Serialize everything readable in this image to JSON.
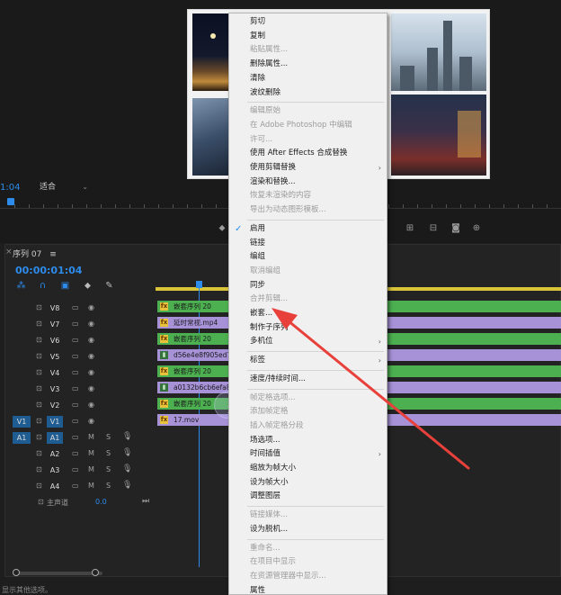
{
  "colors": {
    "accent": "#2d8ceb",
    "clip_green": "#4caf50",
    "clip_purple": "#a792d8",
    "annotation_arrow": "#e8403a",
    "menu_bg": "#f0f0f0"
  },
  "monitor": {
    "timecode": "1:04",
    "fit_label": "适合"
  },
  "sequence": {
    "tab_label": "序列 07",
    "menu_glyph": "≡",
    "timecode": "00:00:01:04"
  },
  "tracks": {
    "video": [
      {
        "name": "V8",
        "src": ""
      },
      {
        "name": "V7",
        "src": ""
      },
      {
        "name": "V6",
        "src": ""
      },
      {
        "name": "V5",
        "src": ""
      },
      {
        "name": "V4",
        "src": ""
      },
      {
        "name": "V3",
        "src": ""
      },
      {
        "name": "V2",
        "src": ""
      },
      {
        "name": "V1",
        "src": "V1"
      }
    ],
    "audio": [
      {
        "name": "A1",
        "src": "A1",
        "m": "M",
        "s": "S"
      },
      {
        "name": "A2",
        "src": "",
        "m": "M",
        "s": "S"
      },
      {
        "name": "A3",
        "src": "",
        "m": "M",
        "s": "S"
      },
      {
        "name": "A4",
        "src": "",
        "m": "M",
        "s": "S"
      }
    ],
    "master_label": "主声道",
    "master_value": "0.0"
  },
  "clips": [
    {
      "label": "嵌套序列 20",
      "color": "green",
      "icon": "fx"
    },
    {
      "label": "延时常视.mp4",
      "color": "purple",
      "icon": "fx"
    },
    {
      "label": "嵌套序列 20",
      "color": "green",
      "icon": "fx"
    },
    {
      "label": "d56e4e8f905ed7245",
      "color": "purple",
      "icon": "film"
    },
    {
      "label": "嵌套序列 20",
      "color": "green",
      "icon": "fx"
    },
    {
      "label": "a0132b6cb6efa89c59",
      "color": "purple",
      "icon": "film"
    },
    {
      "label": "嵌套序列 20",
      "color": "green",
      "icon": "fx"
    },
    {
      "label": "17.mov",
      "color": "purple",
      "icon": "fx"
    }
  ],
  "context_menu": {
    "items": [
      {
        "label": "剪切",
        "enabled": true
      },
      {
        "label": "复制",
        "enabled": true
      },
      {
        "label": "粘贴属性...",
        "enabled": false
      },
      {
        "label": "删除属性...",
        "enabled": true
      },
      {
        "label": "清除",
        "enabled": true
      },
      {
        "label": "波纹删除",
        "enabled": true
      },
      {
        "sep": true
      },
      {
        "label": "编辑原始",
        "enabled": false
      },
      {
        "label": "在 Adobe Photoshop 中编辑",
        "enabled": false
      },
      {
        "label": "许可...",
        "enabled": false
      },
      {
        "label": "使用 After Effects 合成替换",
        "enabled": true
      },
      {
        "label": "使用剪辑替换",
        "enabled": true,
        "submenu": true
      },
      {
        "label": "渲染和替换...",
        "enabled": true
      },
      {
        "label": "恢复未渲染的内容",
        "enabled": false
      },
      {
        "label": "导出为动态图形模板...",
        "enabled": false
      },
      {
        "sep": true
      },
      {
        "label": "启用",
        "enabled": true,
        "checked": true
      },
      {
        "label": "链接",
        "enabled": true
      },
      {
        "label": "编组",
        "enabled": true
      },
      {
        "label": "取消编组",
        "enabled": false
      },
      {
        "label": "同步",
        "enabled": true
      },
      {
        "label": "合并剪辑...",
        "enabled": false
      },
      {
        "label": "嵌套...",
        "enabled": true
      },
      {
        "label": "制作子序列",
        "enabled": true
      },
      {
        "label": "多机位",
        "enabled": true,
        "submenu": true
      },
      {
        "sep": true
      },
      {
        "label": "标签",
        "enabled": true,
        "submenu": true
      },
      {
        "sep": true
      },
      {
        "label": "速度/持续时间...",
        "enabled": true
      },
      {
        "sep": true
      },
      {
        "label": "帧定格选项...",
        "enabled": false
      },
      {
        "label": "添加帧定格",
        "enabled": false
      },
      {
        "label": "插入帧定格分段",
        "enabled": false
      },
      {
        "label": "场选项...",
        "enabled": true
      },
      {
        "label": "时间插值",
        "enabled": true,
        "submenu": true
      },
      {
        "label": "缩放为帧大小",
        "enabled": true
      },
      {
        "label": "设为帧大小",
        "enabled": true
      },
      {
        "label": "调整图层",
        "enabled": true
      },
      {
        "sep": true
      },
      {
        "label": "链接媒体...",
        "enabled": false
      },
      {
        "label": "设为脱机...",
        "enabled": true
      },
      {
        "sep": true
      },
      {
        "label": "重命名...",
        "enabled": false
      },
      {
        "label": "在项目中显示",
        "enabled": false
      },
      {
        "label": "在资源管理器中显示...",
        "enabled": false
      },
      {
        "label": "属性",
        "enabled": true
      }
    ]
  },
  "status_bar": {
    "text": "显示其他选项。"
  }
}
